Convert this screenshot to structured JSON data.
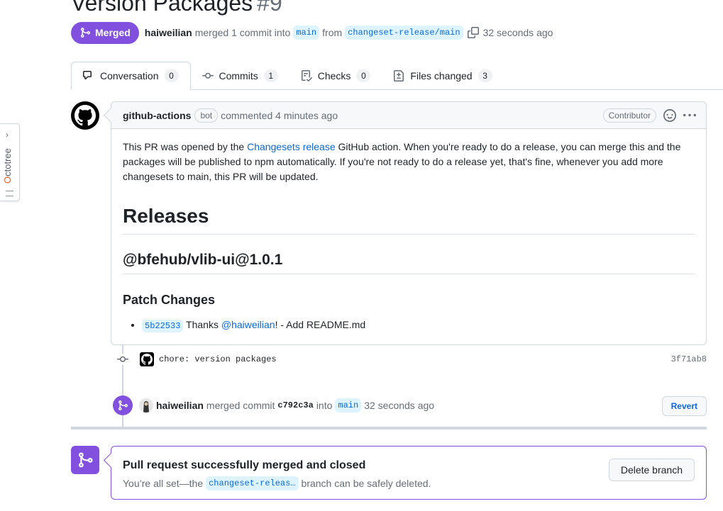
{
  "pr": {
    "title": "Version Packages",
    "number": "#9",
    "state_label": "Merged",
    "author": "haiweilian",
    "merge_summary": "merged 1 commit into",
    "base_branch": "main",
    "from_word": "from",
    "head_branch": "changeset-release/main",
    "time": "32 seconds ago"
  },
  "tabs": [
    {
      "label": "Conversation",
      "count": "0",
      "icon": "comment-discussion-icon"
    },
    {
      "label": "Commits",
      "count": "1",
      "icon": "git-commit-icon"
    },
    {
      "label": "Checks",
      "count": "0",
      "icon": "checklist-icon"
    },
    {
      "label": "Files changed",
      "count": "3",
      "icon": "file-diff-icon"
    }
  ],
  "octotree": {
    "label_first": "O",
    "label_rest": "ctotree"
  },
  "comment": {
    "author": "github-actions",
    "author_badge": "bot",
    "action": "commented 4 minutes ago",
    "role": "Contributor",
    "body_intro_1": "This PR was opened by the ",
    "body_link": "Changesets release",
    "body_intro_2": " GitHub action. When you're ready to do a release, you can merge this and the packages will be published to npm automatically. If you're not ready to do a release yet, that's fine, whenever you add more changesets to main, this PR will be updated.",
    "h1": "Releases",
    "h2": "@bfehub/vlib-ui@1.0.1",
    "h3": "Patch Changes",
    "change_sha": "5b22533",
    "change_thanks": " Thanks ",
    "change_user": "@haiweilian",
    "change_desc": "! - Add README.md"
  },
  "commit": {
    "message": "chore: version packages",
    "sha": "3f71ab8"
  },
  "merge_event": {
    "author": "haiweilian",
    "text": "merged commit",
    "sha": "c792c3a",
    "into": "into",
    "branch": "main",
    "time": "32 seconds ago",
    "revert_label": "Revert"
  },
  "merged_box": {
    "title": "Pull request successfully merged and closed",
    "sub_before": "You’re all set—the",
    "branch": "changeset-releas…",
    "sub_after": "branch can be safely deleted.",
    "delete_label": "Delete branch"
  },
  "colors": {
    "merged": "#8250df",
    "link": "#0969da",
    "border": "#d0d7de",
    "muted": "#656d76"
  }
}
